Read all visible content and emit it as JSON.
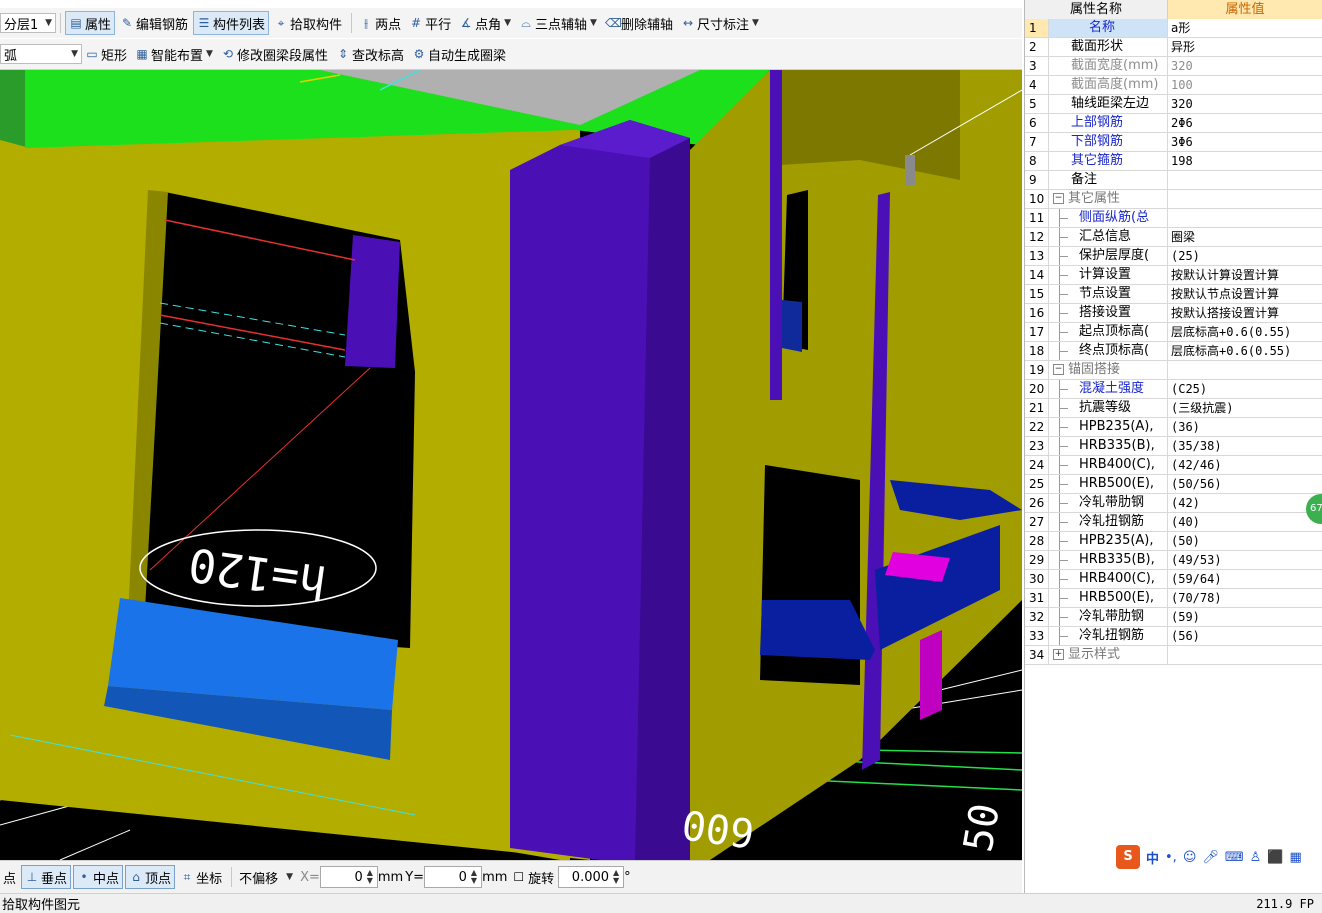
{
  "toolbar1": {
    "floor_combo": "分层1",
    "properties": "属性",
    "edit_rebar": "编辑钢筋",
    "component_list": "构件列表",
    "pick_component": "拾取构件",
    "two_points": "两点",
    "parallel": "平行",
    "point_angle": "点角",
    "three_point_axis": "三点辅轴",
    "delete_axis": "删除辅轴",
    "dimension": "尺寸标注"
  },
  "toolbar2": {
    "arc_combo": "弧",
    "rectangle": "矩形",
    "smart_layout": "智能布置",
    "modify_segment": "修改圈梁段属性",
    "check_elevation": "查改标高",
    "auto_generate": "自动生成圈梁"
  },
  "viewport": {
    "h_label": "h=120",
    "dim_label_1": "600",
    "dim_label_2": "600",
    "dim_label_3": "50"
  },
  "bottombar": {
    "partial_left": "点",
    "perpendicular": "垂点",
    "midpoint": "中点",
    "vertex": "顶点",
    "coordinate": "坐标",
    "offset_mode": "不偏移",
    "x_label": "X=",
    "x_value": "0",
    "y_label": "Y=",
    "y_value": "0",
    "unit": "mm",
    "rotate_label": "旋转",
    "rotate_value": "0.000",
    "degree": "°"
  },
  "status": {
    "message": "拾取构件图元",
    "fps": "211.9 FP"
  },
  "panel": {
    "header_name": "属性名称",
    "header_value": "属性值",
    "rows": [
      {
        "n": "1",
        "name": "名称",
        "value": "a形"
      },
      {
        "n": "2",
        "name": "截面形状",
        "value": "异形"
      },
      {
        "n": "3",
        "name": "截面宽度(mm)",
        "value": "320"
      },
      {
        "n": "4",
        "name": "截面高度(mm)",
        "value": "100"
      },
      {
        "n": "5",
        "name": "轴线距梁左边",
        "value": "320"
      },
      {
        "n": "6",
        "name": "上部钢筋",
        "value": "2Φ6"
      },
      {
        "n": "7",
        "name": "下部钢筋",
        "value": "3Φ6"
      },
      {
        "n": "8",
        "name": "其它箍筋",
        "value": "198"
      },
      {
        "n": "9",
        "name": "备注",
        "value": ""
      },
      {
        "n": "10",
        "name": "其它属性",
        "value": ""
      },
      {
        "n": "11",
        "name": "侧面纵筋(总",
        "value": ""
      },
      {
        "n": "12",
        "name": "汇总信息",
        "value": "圈梁"
      },
      {
        "n": "13",
        "name": "保护层厚度(",
        "value": "(25)"
      },
      {
        "n": "14",
        "name": "计算设置",
        "value": "按默认计算设置计算"
      },
      {
        "n": "15",
        "name": "节点设置",
        "value": "按默认节点设置计算"
      },
      {
        "n": "16",
        "name": "搭接设置",
        "value": "按默认搭接设置计算"
      },
      {
        "n": "17",
        "name": "起点顶标高(",
        "value": "层底标高+0.6(0.55)"
      },
      {
        "n": "18",
        "name": "终点顶标高(",
        "value": "层底标高+0.6(0.55)"
      },
      {
        "n": "19",
        "name": "锚固搭接",
        "value": ""
      },
      {
        "n": "20",
        "name": "混凝土强度",
        "value": "(C25)"
      },
      {
        "n": "21",
        "name": "抗震等级",
        "value": "(三级抗震)"
      },
      {
        "n": "22",
        "name": "HPB235(A),",
        "value": "(36)"
      },
      {
        "n": "23",
        "name": "HRB335(B),",
        "value": "(35/38)"
      },
      {
        "n": "24",
        "name": "HRB400(C),",
        "value": "(42/46)"
      },
      {
        "n": "25",
        "name": "HRB500(E),",
        "value": "(50/56)"
      },
      {
        "n": "26",
        "name": "冷轧带肋钢",
        "value": "(42)"
      },
      {
        "n": "27",
        "name": "冷轧扭钢筋",
        "value": "(40)"
      },
      {
        "n": "28",
        "name": "HPB235(A),",
        "value": "(50)"
      },
      {
        "n": "29",
        "name": "HRB335(B),",
        "value": "(49/53)"
      },
      {
        "n": "30",
        "name": "HRB400(C),",
        "value": "(59/64)"
      },
      {
        "n": "31",
        "name": "HRB500(E),",
        "value": "(70/78)"
      },
      {
        "n": "32",
        "name": "冷轧带肋钢",
        "value": "(59)"
      },
      {
        "n": "33",
        "name": "冷轧扭钢筋",
        "value": "(56)"
      },
      {
        "n": "34",
        "name": "显示样式",
        "value": ""
      }
    ]
  },
  "ime": {
    "badge": "67",
    "lang": "中"
  },
  "colors": {
    "wall": "#b3ad00",
    "beam": "#1de01d",
    "column": "#4a0fb5",
    "sill": "#1a73e8",
    "accent_blue": "#1a27c9"
  }
}
